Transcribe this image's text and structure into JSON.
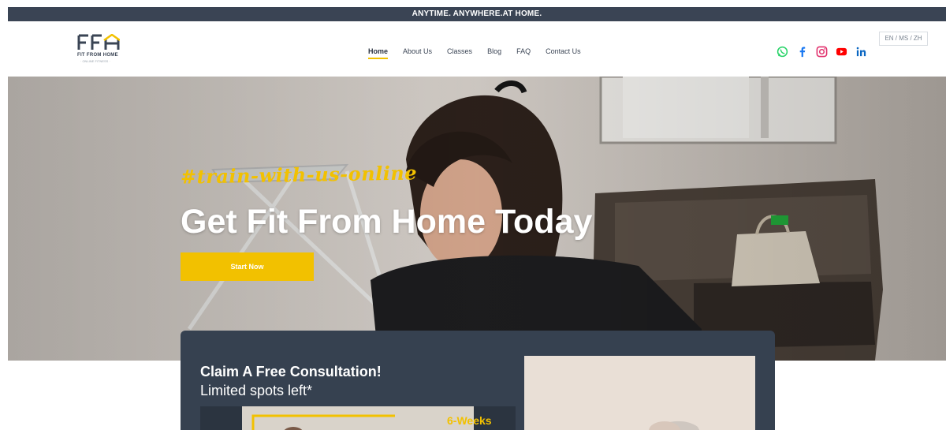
{
  "announcement": "ANYTIME. ANYWHERE.AT HOME.",
  "logo": {
    "text": "FIT FROM HOME",
    "subtext": "· ONLINE FITNESS ·"
  },
  "nav": {
    "items": [
      {
        "label": "Home",
        "active": true
      },
      {
        "label": "About Us",
        "active": false
      },
      {
        "label": "Classes",
        "active": false
      },
      {
        "label": "Blog",
        "active": false
      },
      {
        "label": "FAQ",
        "active": false
      },
      {
        "label": "Contact Us",
        "active": false
      }
    ]
  },
  "socials": [
    {
      "name": "whatsapp-icon",
      "color": "#25d366"
    },
    {
      "name": "facebook-icon",
      "color": "#1877f2"
    },
    {
      "name": "instagram-icon",
      "color": "#e1306c"
    },
    {
      "name": "youtube-icon",
      "color": "#ff0000"
    },
    {
      "name": "linkedin-icon",
      "color": "#0a66c2"
    }
  ],
  "language": "EN / MS / ZH",
  "hero": {
    "hashtag": "#train-with-us-online",
    "title": "Get Fit From Home Today",
    "cta_label": "Start Now"
  },
  "consultation": {
    "title": "Claim A Free Consultation!",
    "subtitle": "Limited spots left*",
    "thumb_badge": "6-Weeks"
  },
  "colors": {
    "accent": "#f2c100",
    "dark": "#364150",
    "topbar": "#3a4454"
  }
}
